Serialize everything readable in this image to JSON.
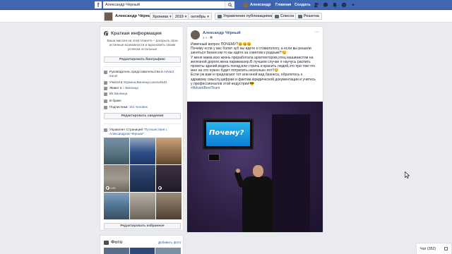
{
  "topbar": {
    "logo": "f",
    "search_value": "Александр Чёрный",
    "user_name": "Александр",
    "home": "Главная",
    "create": "Создать"
  },
  "subnav": {
    "name": "Александр Чёрный",
    "chronicle": "Хроника",
    "year": "2019",
    "month": "октябрь",
    "manage_posts": "Управление публикациями",
    "list_view": "Список",
    "grid_view": "Решетка"
  },
  "intro": {
    "title": "Краткая информация",
    "mission": "Ваша миссия на этой планете – раскрыть свои истинные возможности и вдохновить своим успехом остальных",
    "edit_bio": "Редактировать биографию",
    "rows": [
      {
        "text": "Руководитель представительства в ",
        "link": "Advant travel"
      },
      {
        "text": "Учится в ",
        "link": "Украина,Винница,школа№31"
      },
      {
        "text": "Живет в ",
        "link": "г. Винница"
      },
      {
        "text": "Из ",
        "link": "Винница"
      },
      {
        "text": "В браке",
        "link": ""
      },
      {
        "text": "Подписчики: ",
        "link": "161 человек"
      }
    ],
    "edit_details": "Редактировать сведения",
    "manages_text": "Управляет Страницей ",
    "manages_link": "\"Путешествия с Александром Чёрным\"",
    "video_time": "1:09",
    "edit_featured": "Редактировать избранное"
  },
  "photos": {
    "title": "Фото",
    "add_photo": "Добавить фото"
  },
  "post": {
    "author": "Александр Чёрный",
    "time": "2 ч ·",
    "lines": [
      "Извечный вопрос ПОЧЕМУ?😃😃😃",
      "Почему если у вас болит зуб вы идете к стоматологу, а если вы решили",
      "заняться бизнесом то вы идёте за советом к родным?!😉",
      "У меня мама всю жизнь проработала архитектором,отец машинистом на",
      "железной дороге,жена парикмахер.В лучшем случае я научусь распить",
      "проекты зданий,водить поезд,или стричь и красить людей,это при том что",
      "мне на это нужно будет потратить несколько лет!!☺️",
      "Если уж вам и предлагают тот или иной вид бизнеса, обратитесь к",
      "здравому смыслу,цифрам и фактам,юридической документации и учитесь",
      "у профессионалов этой индустрии!😎"
    ],
    "hashtag": "#AdvantBestTeam",
    "photo_text": "Почему?"
  },
  "chat": {
    "label": "Чат (352)"
  },
  "colors": {
    "brand": "#4267b2",
    "link": "#385898",
    "background": "#e9ebee"
  }
}
